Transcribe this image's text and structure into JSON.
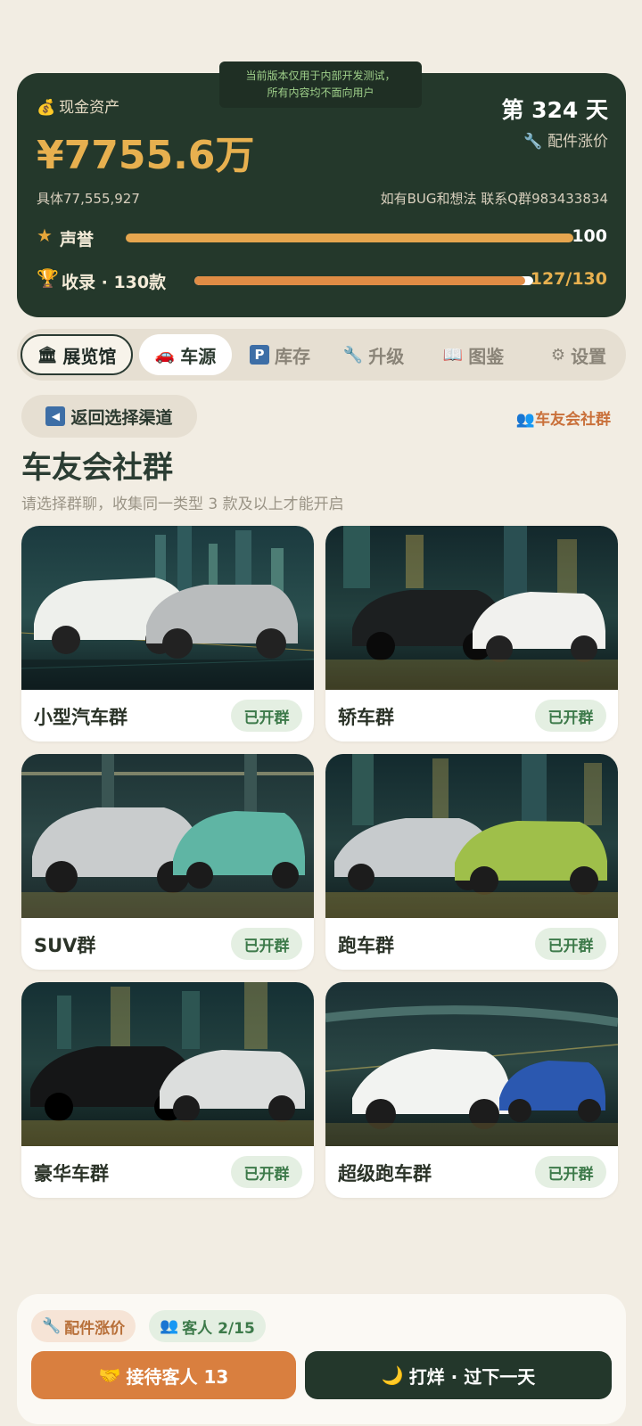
{
  "notice": {
    "line1": "当前版本仅用于内部开发测试，",
    "line2": "所有内容均不面向用户"
  },
  "stats": {
    "cash_label": "现金资产",
    "cash_value": "¥7755.6万",
    "exact_value": "具体77,555,927",
    "day": "第 324 天",
    "parts_rise": "配件涨价",
    "bug_contact": "如有BUG和想法 联系Q群983433834",
    "reputation_label": "声誉",
    "reputation_value": "100",
    "reputation_fraction": 1.0,
    "collection_label": "收录 · 130款",
    "collection_value": "127/130",
    "collection_fraction": 0.977
  },
  "nav": {
    "tabs": [
      {
        "label": "展览馆",
        "icon": "museum-icon"
      },
      {
        "label": "车源",
        "icon": "car-icon"
      },
      {
        "label": "库存",
        "icon": "parking-icon"
      },
      {
        "label": "升级",
        "icon": "wrench-icon"
      },
      {
        "label": "图鉴",
        "icon": "book-icon"
      },
      {
        "label": "设置",
        "icon": "gear-icon"
      }
    ]
  },
  "page": {
    "back_label": "返回选择渠道",
    "community_link": "车友会社群",
    "title": "车友会社群",
    "subtitle": "请选择群聊，收集同一类型 3 款及以上才能开启"
  },
  "groups": [
    {
      "name": "小型汽车群",
      "status": "已开群"
    },
    {
      "name": "轿车群",
      "status": "已开群"
    },
    {
      "name": "SUV群",
      "status": "已开群"
    },
    {
      "name": "跑车群",
      "status": "已开群"
    },
    {
      "name": "豪华车群",
      "status": "已开群"
    },
    {
      "name": "超级跑车群",
      "status": "已开群"
    }
  ],
  "bottom": {
    "parts_chip": "配件涨价",
    "guests_chip": "客人 2/15",
    "receive_button": "接待客人 13",
    "next_day_button": "打烊 · 过下一天"
  },
  "colors": {
    "dark_green": "#24382b",
    "gold": "#e7b04f",
    "orange": "#d97f3f",
    "badge_green": "#3d7a4a",
    "background": "#f2ede3"
  }
}
